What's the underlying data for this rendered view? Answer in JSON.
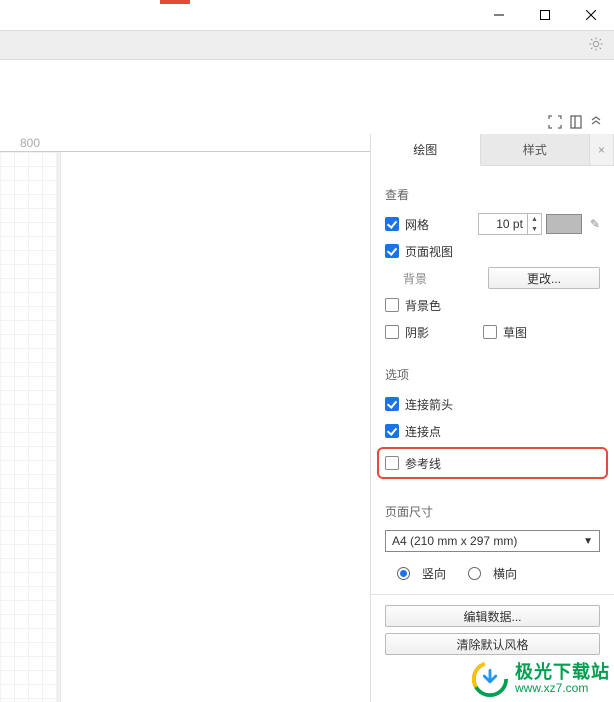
{
  "ruler": {
    "tick_800": "800"
  },
  "tabs": {
    "drawing": "绘图",
    "style": "样式",
    "close": "×"
  },
  "sections": {
    "view": "查看",
    "options": "选项",
    "pageSize": "页面尺寸"
  },
  "view": {
    "grid": "网格",
    "gridSize": "10 pt",
    "pageView": "页面视图",
    "background": "背景",
    "changeBtn": "更改...",
    "bgColor": "背景色",
    "shadow": "阴影",
    "sketch": "草图"
  },
  "options": {
    "connectArrows": "连接箭头",
    "connectPoints": "连接点",
    "guides": "参考线"
  },
  "pageSize": {
    "selected": "A4 (210 mm x 297 mm)",
    "portrait": "竖向",
    "landscape": "横向"
  },
  "buttons": {
    "editData": "编辑数据...",
    "clearStyle": "清除默认风格"
  },
  "watermark": {
    "line1": "极光下载站",
    "line2": "www.xz7.com"
  }
}
